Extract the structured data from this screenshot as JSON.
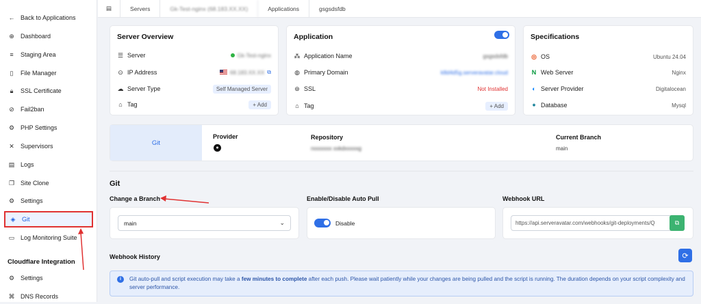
{
  "sidebar": {
    "back_label": "Back to Applications",
    "items": [
      {
        "label": "Dashboard",
        "icon": "dashboard-icon"
      },
      {
        "label": "Staging Area",
        "icon": "staging-icon"
      },
      {
        "label": "File Manager",
        "icon": "file-icon"
      },
      {
        "label": "SSL Certificate",
        "icon": "lock-icon"
      },
      {
        "label": "Fail2ban",
        "icon": "ban-icon"
      },
      {
        "label": "PHP Settings",
        "icon": "php-icon"
      },
      {
        "label": "Supervisors",
        "icon": "tools-icon"
      },
      {
        "label": "Logs",
        "icon": "logs-icon"
      },
      {
        "label": "Site Clone",
        "icon": "clone-icon"
      },
      {
        "label": "Settings",
        "icon": "gear-icon"
      },
      {
        "label": "Git",
        "icon": "git-icon"
      },
      {
        "label": "Log Monitoring Suite",
        "icon": "monitor-icon"
      }
    ],
    "section_cloudflare": "Cloudflare Integration",
    "cf_items": [
      {
        "label": "Settings",
        "icon": "gear-icon"
      },
      {
        "label": "DNS Records",
        "icon": "dns-icon"
      }
    ]
  },
  "topbar": {
    "crumbs": [
      "Servers",
      "Gk-Test-nginx (68.183.XX.XX)",
      "Applications",
      "gsgsdsfdb"
    ]
  },
  "server_overview": {
    "title": "Server Overview",
    "server_label": "Server",
    "server_value": "Gk-Test-nginx",
    "ip_label": "IP Address",
    "ip_value": "68.183.XX.XX",
    "type_label": "Server Type",
    "type_value": "Self Managed Server",
    "tag_label": "Tag",
    "add_label": "+ Add"
  },
  "application": {
    "title": "Application",
    "name_label": "Application Name",
    "name_value": "gsgsdsfdb",
    "domain_label": "Primary Domain",
    "domain_value": "k8d4d5g.serveravatar.cloud",
    "ssl_label": "SSL",
    "ssl_value": "Not Installed",
    "tag_label": "Tag",
    "add_label": "+ Add"
  },
  "specs": {
    "title": "Specifications",
    "os_label": "OS",
    "os_value": "Ubuntu 24.04",
    "web_label": "Web Server",
    "web_value": "Nginx",
    "provider_label": "Server Provider",
    "provider_value": "Digitalocean",
    "db_label": "Database",
    "db_value": "Mysql"
  },
  "git_card": {
    "tab": "Git",
    "provider_label": "Provider",
    "repo_label": "Repository",
    "repo_value": "rxxxxxxx xxkdxxxxxg",
    "branch_label": "Current Branch",
    "branch_value": "main"
  },
  "git_section": {
    "title": "Git",
    "change_branch_label": "Change a Branch",
    "branch_selected": "main",
    "autopull_label": "Enable/Disable Auto Pull",
    "autopull_state": "Disable",
    "webhook_label": "Webhook URL",
    "webhook_value": "https://api.serveravatar.com/webhooks/git-deployments/Q",
    "history_label": "Webhook History",
    "info_prefix": "Git auto-pull and script execution may take a ",
    "info_bold": "few minutes to complete",
    "info_suffix": " after each push. Please wait patiently while your changes are being pulled and the script is running. The duration depends on your script complexity and server performance."
  },
  "colors": {
    "accent": "#2f6fe6",
    "danger": "#e03131",
    "success": "#3cb371"
  }
}
